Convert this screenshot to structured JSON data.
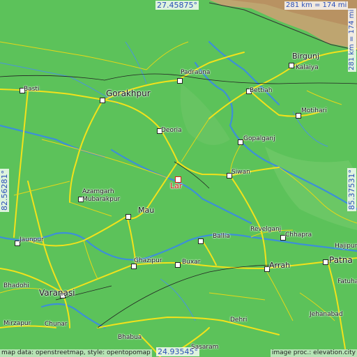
{
  "colors": {
    "land": "#5cc25a",
    "hills": "#c9a272",
    "river": "#3d8fd8",
    "road": "#f2e21b",
    "highlight": "#e01818",
    "coord_text": "#2a4fb8"
  },
  "coords": {
    "top": "27.45875°",
    "bottom": "24.93545°",
    "left": "82.56281°",
    "right": "85.37531°"
  },
  "scale": {
    "top": "281 km = 174 mi",
    "right": "281 km = 174 mi"
  },
  "cities": [
    {
      "name": "Birgunj",
      "icon": "town-marker-icon"
    },
    {
      "name": "Kalaiya",
      "icon": "town-marker-icon"
    },
    {
      "name": "Padrauna",
      "icon": "town-marker-icon"
    },
    {
      "name": "Basti",
      "icon": "town-marker-icon"
    },
    {
      "name": "Gorakhpur",
      "icon": "town-marker-icon"
    },
    {
      "name": "Bettiah",
      "icon": "town-marker-icon"
    },
    {
      "name": "Motihari",
      "icon": "town-marker-icon"
    },
    {
      "name": "Deoria",
      "icon": "town-marker-icon"
    },
    {
      "name": "Gopalganj",
      "icon": "town-marker-icon"
    },
    {
      "name": "Siwan",
      "icon": "town-marker-icon"
    },
    {
      "name": "Azamgarh",
      "icon": "town-marker-icon"
    },
    {
      "name": "Mubarakpur",
      "icon": "town-marker-icon"
    },
    {
      "name": "Mau",
      "icon": "town-marker-icon"
    },
    {
      "name": "Jaunpur",
      "icon": "town-marker-icon"
    },
    {
      "name": "Revelganj",
      "icon": "town-marker-icon"
    },
    {
      "name": "Chhapra",
      "icon": "town-marker-icon"
    },
    {
      "name": "Ballia",
      "icon": "town-marker-icon"
    },
    {
      "name": "Hajipur",
      "icon": "town-marker-icon"
    },
    {
      "name": "Ghazipur",
      "icon": "town-marker-icon"
    },
    {
      "name": "Buxar",
      "icon": "town-marker-icon"
    },
    {
      "name": "Arrah",
      "icon": "town-marker-icon"
    },
    {
      "name": "Patna",
      "icon": "town-marker-icon"
    },
    {
      "name": "Bhadohi",
      "icon": "town-marker-icon"
    },
    {
      "name": "Varanasi",
      "icon": "town-marker-icon"
    },
    {
      "name": "Fatuha",
      "icon": "town-marker-icon"
    },
    {
      "name": "Mirzapur",
      "icon": "town-marker-icon"
    },
    {
      "name": "Chunar",
      "icon": "town-marker-icon"
    },
    {
      "name": "Dehri",
      "icon": "town-marker-icon"
    },
    {
      "name": "Jehanabad",
      "icon": "town-marker-icon"
    },
    {
      "name": "Bhabua",
      "icon": "town-marker-icon"
    },
    {
      "name": "Sasaram",
      "icon": "town-marker-icon"
    }
  ],
  "highlight_city": {
    "name": "Lar",
    "icon": "location-marker-icon"
  },
  "credits": {
    "left": "map data: openstreetmap, style: opentopomap",
    "right": "image proc.: elevation.city"
  }
}
